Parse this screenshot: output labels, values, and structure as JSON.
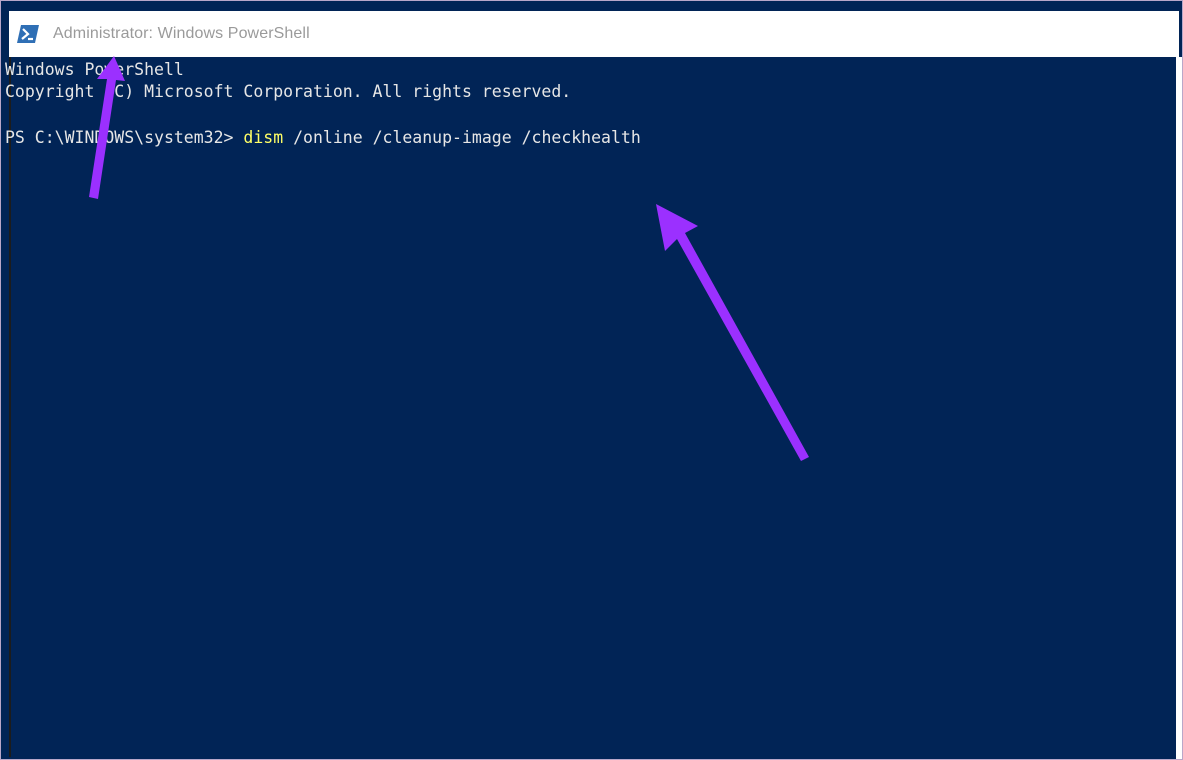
{
  "window": {
    "title": "Administrator: Windows PowerShell",
    "icon": "powershell-icon"
  },
  "console": {
    "line1": "Windows PowerShell",
    "line2": "Copyright (C) Microsoft Corporation. All rights reserved.",
    "prompt": "PS C:\\WINDOWS\\system32> ",
    "command_keyword": "dism",
    "command_args": " /online /cleanup-image /checkhealth"
  },
  "colors": {
    "console_background": "#012456",
    "command_keyword": "#ffff66",
    "annotation_arrow": "#9b30ff"
  }
}
